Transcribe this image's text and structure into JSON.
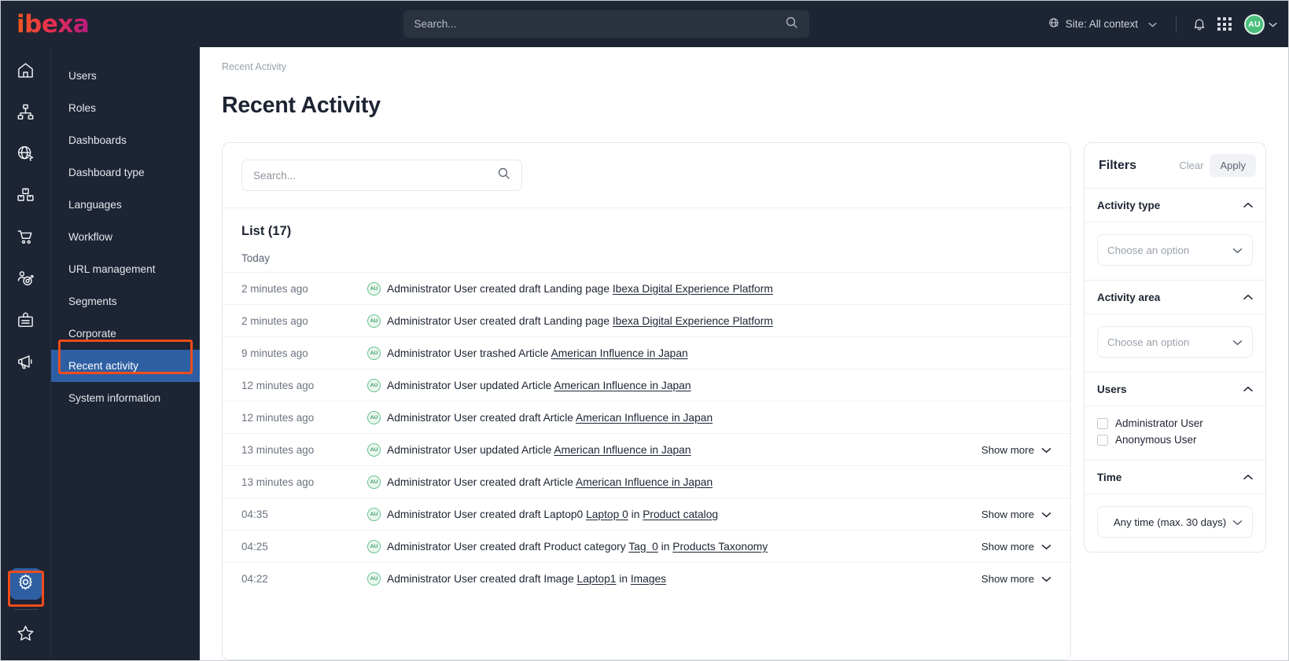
{
  "header": {
    "logo_text": "ibexa",
    "search_placeholder": "Search...",
    "site_context_label": "Site: All context",
    "avatar_initials": "AU",
    "icons": {
      "globe": "globe-icon",
      "chevron": "chevron-down-icon",
      "bell": "bell-icon",
      "apps": "apps-grid-icon",
      "search": "search-icon"
    }
  },
  "rail": {
    "items": [
      {
        "name": "home",
        "label": "Home"
      },
      {
        "name": "content-structure",
        "label": "Content structure"
      },
      {
        "name": "site-preview",
        "label": "Site"
      },
      {
        "name": "products",
        "label": "Products"
      },
      {
        "name": "commerce-cart",
        "label": "Commerce"
      },
      {
        "name": "customer-targeting",
        "label": "Personalization"
      },
      {
        "name": "membership-card",
        "label": "Customers"
      },
      {
        "name": "campaign-megaphone",
        "label": "Campaigns"
      }
    ],
    "bottom": [
      {
        "name": "settings-gear",
        "label": "Admin",
        "active": true
      },
      {
        "name": "bookmark-star",
        "label": "Bookmarks",
        "active": false
      }
    ]
  },
  "subnav": {
    "items": [
      {
        "label": "Users",
        "active": false
      },
      {
        "label": "Roles",
        "active": false
      },
      {
        "label": "Dashboards",
        "active": false
      },
      {
        "label": "Dashboard type",
        "active": false
      },
      {
        "label": "Languages",
        "active": false
      },
      {
        "label": "Workflow",
        "active": false
      },
      {
        "label": "URL management",
        "active": false
      },
      {
        "label": "Segments",
        "active": false
      },
      {
        "label": "Corporate",
        "active": false
      },
      {
        "label": "Recent activity",
        "active": true
      },
      {
        "label": "System information",
        "active": false
      }
    ]
  },
  "main": {
    "breadcrumb": "Recent Activity",
    "page_title": "Recent Activity",
    "search_placeholder": "Search...",
    "list_heading": "List (17)",
    "group_label": "Today",
    "show_more_label": "Show more",
    "rows": [
      {
        "time": "2 minutes ago",
        "avatar": "AU",
        "pre": "Administrator User created draft Landing page ",
        "link1": "Ibexa Digital Experience Platform",
        "mid": "",
        "link2": "",
        "show_more": false
      },
      {
        "time": "2 minutes ago",
        "avatar": "AU",
        "pre": "Administrator User created draft Landing page ",
        "link1": "Ibexa Digital Experience Platform",
        "mid": "",
        "link2": "",
        "show_more": false
      },
      {
        "time": "9 minutes ago",
        "avatar": "AU",
        "pre": "Administrator User trashed Article ",
        "link1": "American Influence in Japan",
        "mid": "",
        "link2": "",
        "show_more": false
      },
      {
        "time": "12 minutes ago",
        "avatar": "AU",
        "pre": "Administrator User updated Article ",
        "link1": "American Influence in Japan",
        "mid": "",
        "link2": "",
        "show_more": false
      },
      {
        "time": "12 minutes ago",
        "avatar": "AU",
        "pre": "Administrator User created draft Article ",
        "link1": "American Influence in Japan",
        "mid": "",
        "link2": "",
        "show_more": false
      },
      {
        "time": "13 minutes ago",
        "avatar": "AU",
        "pre": "Administrator User updated Article ",
        "link1": "American Influence in Japan",
        "mid": "",
        "link2": "",
        "show_more": true
      },
      {
        "time": "13 minutes ago",
        "avatar": "AU",
        "pre": "Administrator User created draft Article ",
        "link1": "American Influence in Japan",
        "mid": "",
        "link2": "",
        "show_more": false
      },
      {
        "time": "04:35",
        "avatar": "AU",
        "pre": "Administrator User created draft Laptop0 ",
        "link1": "Laptop 0",
        "mid": " in ",
        "link2": "Product catalog",
        "show_more": true
      },
      {
        "time": "04:25",
        "avatar": "AU",
        "pre": "Administrator User created draft Product category ",
        "link1": "Tag_0",
        "mid": " in ",
        "link2": "Products Taxonomy",
        "show_more": true
      },
      {
        "time": "04:22",
        "avatar": "AU",
        "pre": "Administrator User created draft Image ",
        "link1": "Laptop1",
        "mid": " in ",
        "link2": "Images",
        "show_more": true
      }
    ]
  },
  "filters": {
    "title": "Filters",
    "clear_label": "Clear",
    "apply_label": "Apply",
    "sections": [
      {
        "title": "Activity type",
        "kind": "select",
        "placeholder": "Choose an option"
      },
      {
        "title": "Activity area",
        "kind": "select",
        "placeholder": "Choose an option"
      },
      {
        "title": "Users",
        "kind": "checks",
        "options": [
          "Administrator User",
          "Anonymous User"
        ]
      },
      {
        "title": "Time",
        "kind": "value",
        "value": "Any time (max. 30 days)"
      }
    ]
  }
}
